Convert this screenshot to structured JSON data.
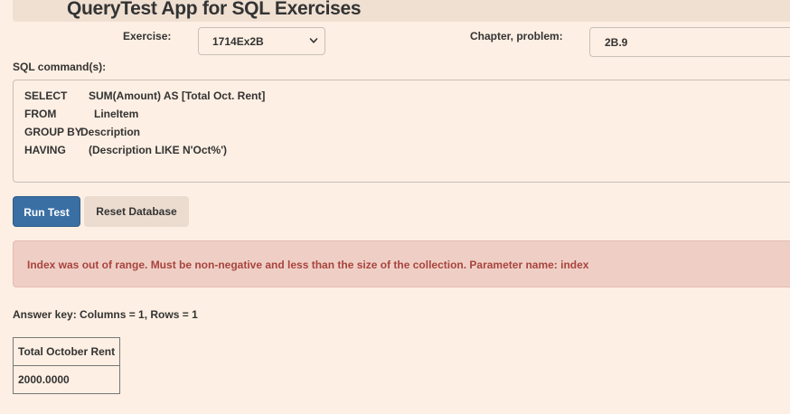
{
  "header": {
    "title": "QueryTest App for SQL Exercises"
  },
  "exercise": {
    "label": "Exercise:",
    "selected": "1714Ex2B"
  },
  "chapter": {
    "label": "Chapter, problem:",
    "value": "2B.9"
  },
  "sql": {
    "label": "SQL command(s):",
    "lines": [
      {
        "keyword": "SELECT",
        "rest": "SUM(Amount) AS [Total Oct. Rent]"
      },
      {
        "keyword": "FROM",
        "rest": "LineItem"
      },
      {
        "keyword": "GROUP BY",
        "rest": "Description"
      },
      {
        "keyword": "HAVING",
        "rest": "(Description LIKE N'Oct%')"
      }
    ]
  },
  "buttons": {
    "run_test": "Run Test",
    "reset_database": "Reset Database"
  },
  "error": {
    "message": "Index was out of range. Must be non-negative and less than the size of the collection. Parameter name: index"
  },
  "answer_key": {
    "summary": "Answer key: Columns = 1, Rows = 1",
    "columns": [
      "Total October Rent"
    ],
    "rows": [
      [
        "2000.0000"
      ]
    ]
  },
  "colors": {
    "background": "#fdefe3",
    "primary_button": "#3a6fa4",
    "error_text": "#a8443f",
    "error_background": "#efcfc5"
  },
  "icons": {
    "select_arrow": "chevron-down-icon"
  }
}
